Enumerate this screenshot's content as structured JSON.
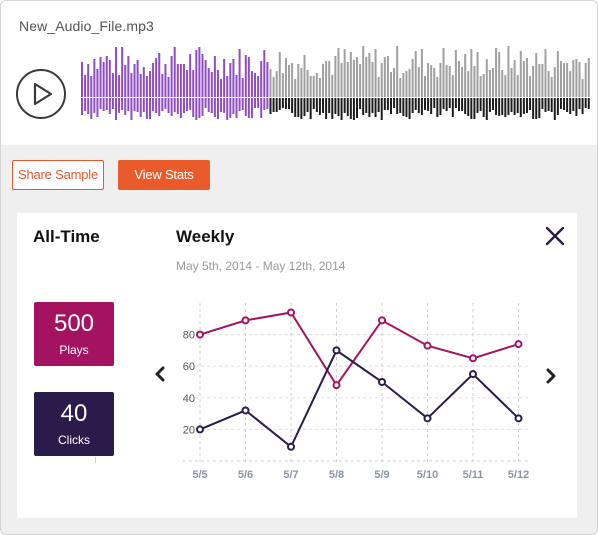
{
  "player": {
    "file_name": "New_Audio_File.mp3",
    "played_color": "#8e4dc0",
    "unplayed_color": "#a0a0a0",
    "bottom_color": "#1c1c1c",
    "progress_fraction": 0.37
  },
  "actions": {
    "share_label": "Share Sample",
    "stats_label": "View Stats"
  },
  "all_time": {
    "title": "All-Time",
    "plays": {
      "value": "500",
      "label": "Plays",
      "color": "#a3135f"
    },
    "clicks": {
      "value": "40",
      "label": "Clicks",
      "color": "#2b1b4a"
    }
  },
  "weekly": {
    "title": "Weekly",
    "date_range": "May 5th, 2014 - May 12th, 2014"
  },
  "icons": {
    "play": "play-icon",
    "close": "close-icon",
    "prev": "chevron-left-icon",
    "next": "chevron-right-icon"
  },
  "chart_data": {
    "type": "line",
    "categories": [
      "5/5",
      "5/6",
      "5/7",
      "5/8",
      "5/9",
      "5/10",
      "5/11",
      "5/12"
    ],
    "series": [
      {
        "color": "#a3135f",
        "values": [
          80,
          89,
          94,
          48,
          89,
          73,
          65,
          74
        ]
      },
      {
        "color": "#2b1b4a",
        "values": [
          20,
          32,
          9,
          70,
          50,
          27,
          55,
          27
        ]
      }
    ],
    "yticks": [
      20,
      40,
      60,
      80
    ],
    "ylim": [
      0,
      100
    ],
    "grid": true,
    "title": "",
    "xlabel": "",
    "ylabel": ""
  }
}
